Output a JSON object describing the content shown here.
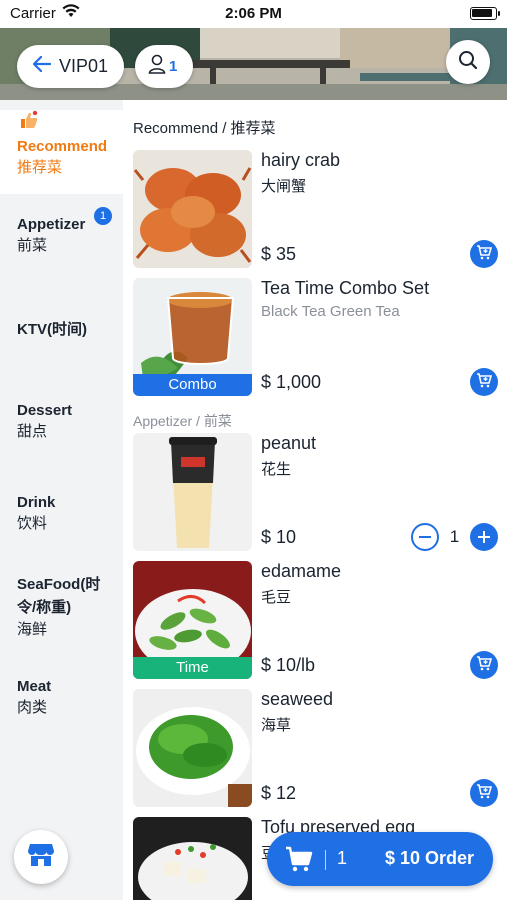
{
  "status_bar": {
    "carrier": "Carrier",
    "time": "2:06 PM"
  },
  "header": {
    "table_label": "VIP01",
    "guest_count": "1"
  },
  "sidebar": {
    "categories": [
      {
        "en": "Recommend",
        "zh": "推荐菜",
        "active": true
      },
      {
        "en": "Appetizer",
        "zh": "前菜",
        "badge": "1"
      },
      {
        "en": "KTV(时间)",
        "zh": ""
      },
      {
        "en": "Dessert",
        "zh": "甜点"
      },
      {
        "en": "Drink",
        "zh": "饮料"
      },
      {
        "en": "SeaFood(时令/称重)",
        "en_line1": "SeaFood(时",
        "en_line2": "令/称重)",
        "zh": "海鲜"
      },
      {
        "en": "Meat",
        "zh": "肉类"
      }
    ]
  },
  "sections": {
    "recommend_title": "Recommend / 推荐菜",
    "appetizer_title": "Appetizer / 前菜"
  },
  "items": [
    {
      "name": "hairy crab",
      "desc": "大闸蟹",
      "price": "$ 35",
      "tag": ""
    },
    {
      "name": "Tea Time Combo Set",
      "desc": "Black Tea Green Tea",
      "price": "$ 1,000",
      "tag": "Combo",
      "tag_color": "#1f6fe5"
    },
    {
      "name": "peanut",
      "desc": "花生",
      "price": "$ 10",
      "tag": "",
      "qty": "1"
    },
    {
      "name": "edamame",
      "desc": "毛豆",
      "price": "$ 10/lb",
      "tag": "Time",
      "tag_color": "#17b37a"
    },
    {
      "name": "seaweed",
      "desc": "海草",
      "price": "$ 12",
      "tag": ""
    },
    {
      "name": "Tofu preserved egg",
      "desc": "豆",
      "price": "",
      "tag": ""
    }
  ],
  "order_bar": {
    "count": "1",
    "total": "$ 10 Order"
  },
  "colors": {
    "accent": "#1f6fe5",
    "active_category": "#f07a13",
    "combo_tag": "#1f6fe5",
    "time_tag": "#17b37a"
  }
}
